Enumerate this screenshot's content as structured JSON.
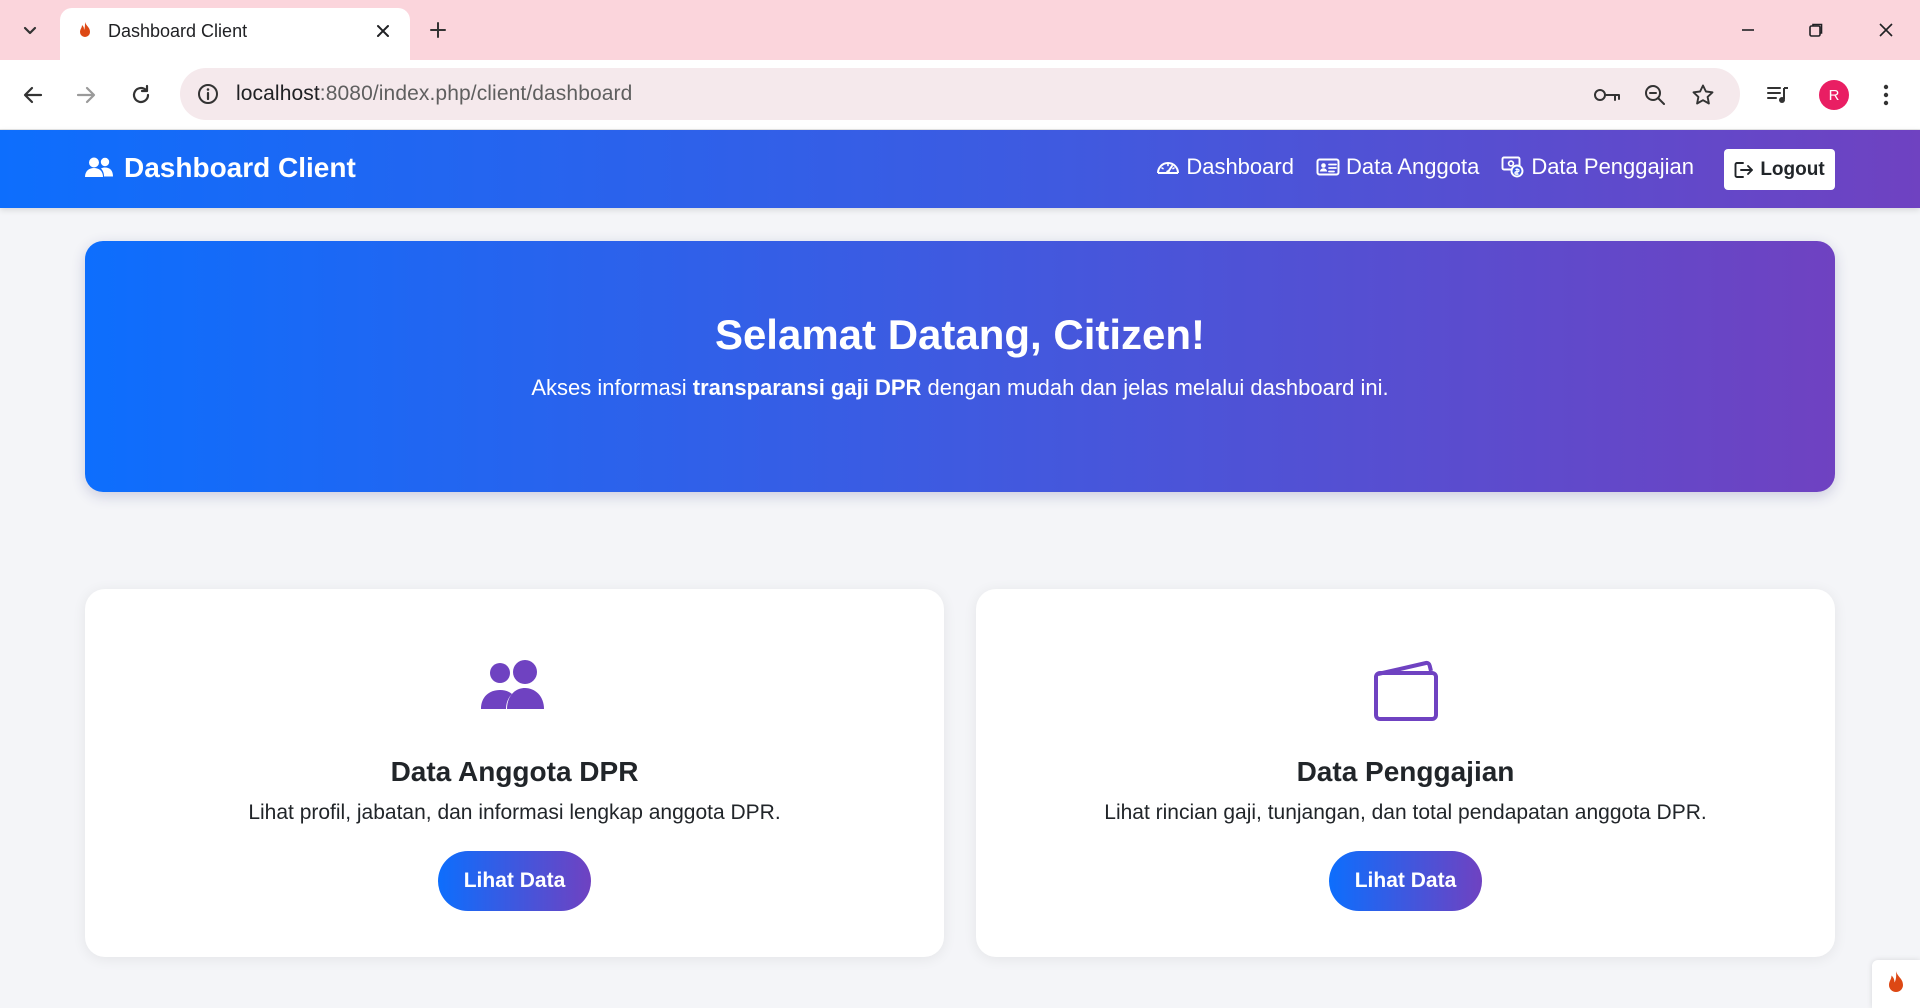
{
  "browser": {
    "tab_title": "Dashboard Client",
    "url_host": "localhost",
    "url_rest": ":8080/index.php/client/dashboard",
    "profile_initial": "R"
  },
  "navbar": {
    "brand": "Dashboard Client",
    "links": [
      {
        "label": "Dashboard",
        "icon": "speedometer-icon"
      },
      {
        "label": "Data Anggota",
        "icon": "id-card-icon"
      },
      {
        "label": "Data Penggajian",
        "icon": "cash-coin-icon"
      }
    ],
    "logout_label": "Logout"
  },
  "hero": {
    "title": "Selamat Datang, Citizen!",
    "subtitle_before": "Akses informasi ",
    "subtitle_bold": "transparansi gaji DPR",
    "subtitle_after": " dengan mudah dan jelas melalui dashboard ini."
  },
  "cards": [
    {
      "icon": "people-icon",
      "title": "Data Anggota DPR",
      "text": "Lihat profil, jabatan, dan informasi lengkap anggota DPR.",
      "button": "Lihat Data"
    },
    {
      "icon": "wallet-icon",
      "title": "Data Penggajian",
      "text": "Lihat rincian gaji, tunjangan, dan total pendapatan anggota DPR.",
      "button": "Lihat Data"
    }
  ],
  "colors": {
    "primary": "#0d6efd",
    "accent": "#6f42c1",
    "tab_strip": "#fbd5dc"
  }
}
